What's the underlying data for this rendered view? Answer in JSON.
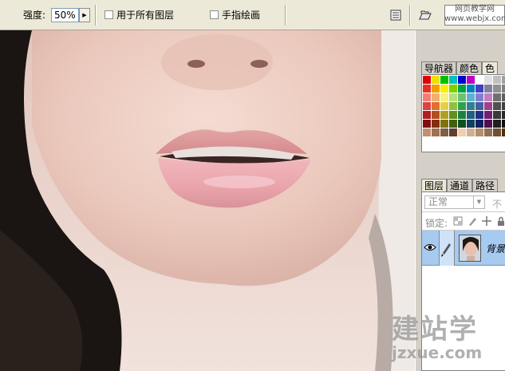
{
  "options_bar": {
    "strength_label": "强度:",
    "strength_value": "50%",
    "sample_all_layers_label": "用于所有图层",
    "finger_painting_label": "手指绘画"
  },
  "watermarks": {
    "top_right_line1": "网页教学网",
    "top_right_line2": "www.webjx.com",
    "site_cn": "建站学",
    "site_url": "jzxue.com"
  },
  "panels": {
    "top_tabs": [
      "导航器",
      "颜色",
      "色"
    ],
    "layer_tabs": [
      "图层",
      "通道",
      "路径"
    ],
    "blend_mode": "正常",
    "opacity_label": "不",
    "lock_label": "锁定:",
    "layers": [
      {
        "name": "背景",
        "visible": true
      }
    ]
  },
  "swatch_colors": [
    "#e00000",
    "#f0e000",
    "#00c000",
    "#00c0c0",
    "#0000d0",
    "#c000c0",
    "#ffffff",
    "#e0e0e0",
    "#c0c0c0",
    "#a0a0a0",
    "#e83020",
    "#f0a000",
    "#f8f000",
    "#80d000",
    "#00a040",
    "#0080c0",
    "#4040c0",
    "#8080a0",
    "#909090",
    "#808080",
    "#f08070",
    "#f0b070",
    "#f8f080",
    "#b0e080",
    "#70c070",
    "#60b0d0",
    "#8080d0",
    "#c080c0",
    "#707070",
    "#606060",
    "#e04040",
    "#e07030",
    "#e8d040",
    "#90c040",
    "#30a050",
    "#308090",
    "#4060a0",
    "#a04090",
    "#505050",
    "#404040",
    "#b02020",
    "#b05020",
    "#b0a020",
    "#609020",
    "#208040",
    "#206080",
    "#203080",
    "#702070",
    "#383838",
    "#282828",
    "#801010",
    "#803010",
    "#807010",
    "#406010",
    "#105020",
    "#104060",
    "#102060",
    "#501050",
    "#202020",
    "#101010",
    "#c09070",
    "#a07050",
    "#806040",
    "#604030",
    "#f0d0b0",
    "#d0b090",
    "#b09070",
    "#907050",
    "#705030",
    "#503010"
  ],
  "colors": {
    "ui_bg": "#d4d0c8",
    "options_bg": "#ece9d8",
    "layer_selected": "#a6caf0"
  }
}
